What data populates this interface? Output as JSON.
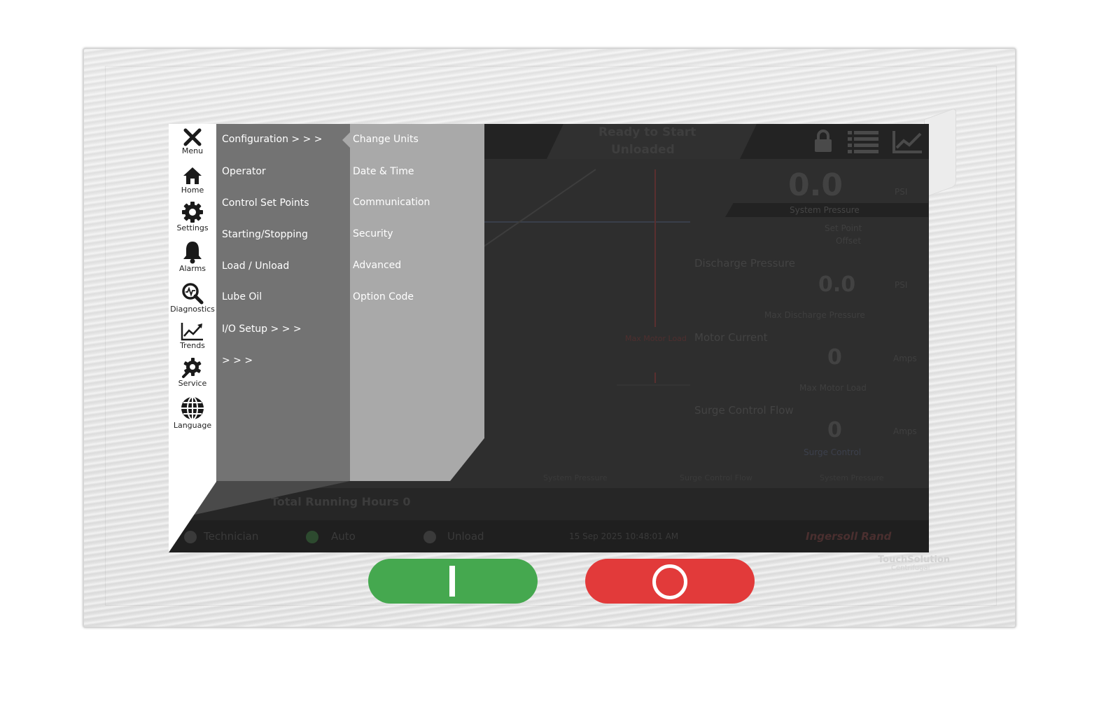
{
  "sidebar": {
    "items": [
      {
        "label": "Menu",
        "icon": "close-icon"
      },
      {
        "label": "Home",
        "icon": "home-icon"
      },
      {
        "label": "Settings",
        "icon": "gear-icon"
      },
      {
        "label": "Alarms",
        "icon": "bell-icon"
      },
      {
        "label": "Diagnostics",
        "icon": "magnifier-icon"
      },
      {
        "label": "Trends",
        "icon": "trend-chart-icon"
      },
      {
        "label": "Service",
        "icon": "service-wrench-icon"
      },
      {
        "label": "Language",
        "icon": "globe-icon"
      }
    ]
  },
  "settings_menu": {
    "items": [
      "Configuration > > >",
      "Operator",
      "Control Set Points",
      "Starting/Stopping",
      "Load / Unload",
      "Lube Oil",
      "I/O Setup > > >",
      "> > >"
    ]
  },
  "configuration_submenu": {
    "items": [
      "Change Units",
      "Date & Time",
      "Communication",
      "Security",
      "Advanced",
      "Option Code"
    ]
  },
  "background": {
    "status_line1": "Ready to Start",
    "status_line2": "Unloaded",
    "system_pressure_value": "0.0",
    "system_pressure_unit": "PSI",
    "system_pressure_label": "System Pressure",
    "set_point_label": "Set Point",
    "offset_label": "Offset",
    "discharge_pressure_label": "Discharge Pressure",
    "discharge_pressure_value": "0.0",
    "discharge_pressure_unit": "PSI",
    "max_discharge_label": "Max Discharge Pressure",
    "motor_current_label": "Motor Current",
    "motor_current_value": "0",
    "motor_current_unit": "Amps",
    "max_motor_load_label": "Max Motor Load",
    "surge_control_flow_label": "Surge Control Flow",
    "surge_control_flow_value": "0",
    "surge_control_flow_unit": "Amps",
    "surge_control_label": "Surge Control",
    "max_motor_chart_label": "Max Motor Load",
    "legend_system_pressure": "System Pressure",
    "legend_surge_flow": "Surge Control Flow",
    "legend_system_pressure2": "System Pressure",
    "total_running_hours": "Total Running Hours 0",
    "user": "Technician",
    "mode": "Auto",
    "load_state": "Unload",
    "datetime": "15 Sep 2025 10:48:01 AM",
    "brand": "Ingersoll Rand"
  },
  "buttons": {
    "start_color": "#45a84f",
    "stop_color": "#e23a3a"
  },
  "bezel_brand": {
    "line1": "TouchSolution",
    "line2": "Centrifugal"
  }
}
